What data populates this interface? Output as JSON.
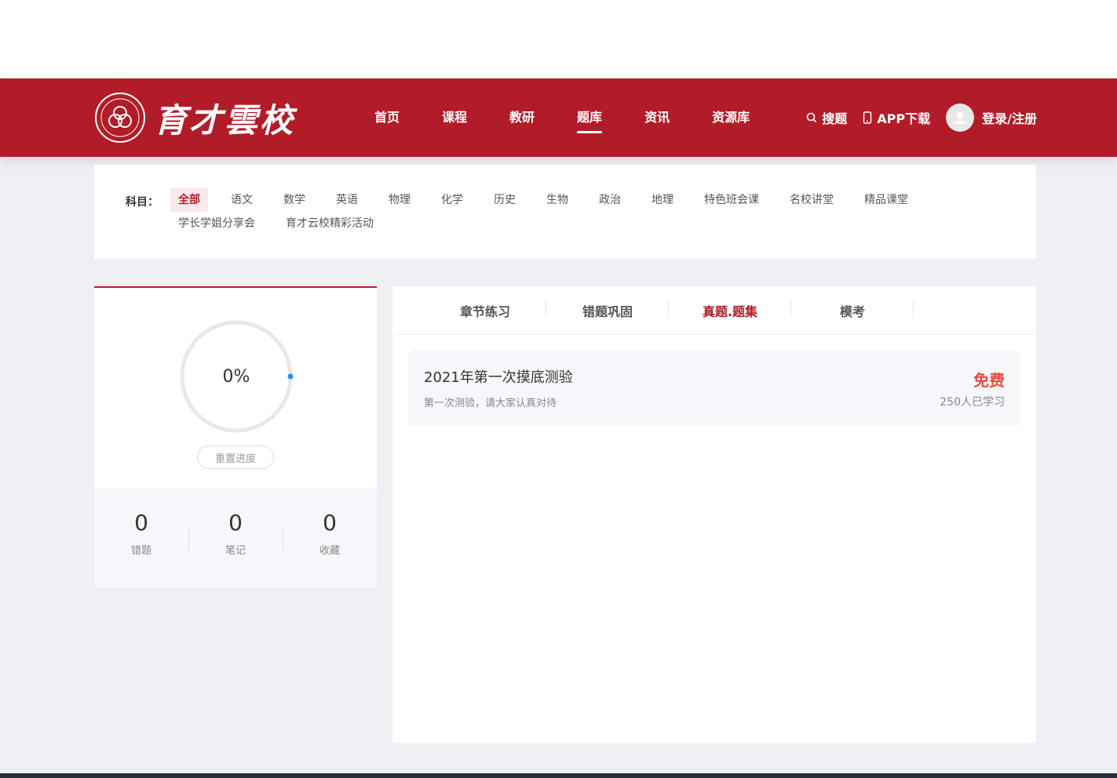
{
  "header": {
    "logo_text": "育才雲校",
    "nav": [
      {
        "label": "首页",
        "active": false
      },
      {
        "label": "课程",
        "active": false
      },
      {
        "label": "教研",
        "active": false
      },
      {
        "label": "题库",
        "active": true
      },
      {
        "label": "资讯",
        "active": false
      },
      {
        "label": "资源库",
        "active": false
      }
    ],
    "search_label": "搜题",
    "app_label": "APP下载",
    "login_label": "登录/注册"
  },
  "filter": {
    "label": "科目：",
    "subjects": [
      "全部",
      "语文",
      "数学",
      "英语",
      "物理",
      "化学",
      "历史",
      "生物",
      "政治",
      "地理",
      "特色班会课",
      "名校讲堂",
      "精品课堂",
      "学长学姐分享会",
      "育才云校精彩活动"
    ],
    "active_index": 0
  },
  "progress": {
    "percent_text": "0%",
    "percent": 0,
    "reset_label": "重置进度",
    "stats": [
      {
        "value": "0",
        "label": "错题"
      },
      {
        "value": "0",
        "label": "笔记"
      },
      {
        "value": "0",
        "label": "收藏"
      }
    ]
  },
  "tabs": [
    {
      "label": "章节练习",
      "active": false
    },
    {
      "label": "错题巩固",
      "active": false
    },
    {
      "label": "真题.题集",
      "active": true
    },
    {
      "label": "模考",
      "active": false
    }
  ],
  "exams": [
    {
      "title": "2021年第一次摸底测验",
      "desc": "第一次测验，请大家认真对待",
      "price": "免费",
      "count": "250人已学习"
    }
  ],
  "colors": {
    "brand": "#b11c28",
    "price": "#e84b3c",
    "progress_dot": "#2196f3"
  }
}
